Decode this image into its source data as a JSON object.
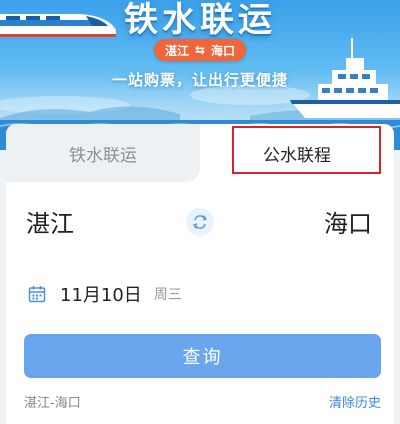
{
  "banner": {
    "title": "铁水联运",
    "route": {
      "from": "湛江",
      "to": "海口",
      "swap_glyph": "⇆"
    },
    "slogan": "一站购票，让出行更便捷"
  },
  "tabs": [
    {
      "label": "铁水联运",
      "active": false
    },
    {
      "label": "公水联程",
      "active": true
    }
  ],
  "form": {
    "from_station": "湛江",
    "to_station": "海口",
    "date": "11月10日",
    "weekday": "周三",
    "query_label": "查询"
  },
  "history": {
    "items": [
      "湛江-海口"
    ],
    "clear_label": "清除历史"
  },
  "colors": {
    "accent": "#6aa6ee",
    "highlight_border": "#d9232e",
    "pill": "#f0653a",
    "link": "#3a86e0"
  }
}
